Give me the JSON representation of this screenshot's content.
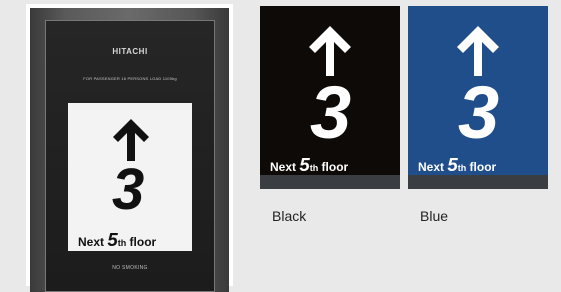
{
  "photo": {
    "brand": "HITACHI",
    "capacity_text": "FOR PASSENGER   16 PERSONS   LOAD   1100kg",
    "floor_number": "3",
    "next_word": "Next",
    "next_floor_number": "5",
    "next_floor_suffix": "th",
    "floor_word": "floor",
    "notice": "NO SMOKING"
  },
  "variants": [
    {
      "label": "Black",
      "background": "#0d0a08",
      "floor_number": "3",
      "next_word": "Next",
      "next_floor_number": "5",
      "next_floor_suffix": "th",
      "floor_word": "floor"
    },
    {
      "label": "Blue",
      "background": "#1f4e8b",
      "floor_number": "3",
      "next_word": "Next",
      "next_floor_number": "5",
      "next_floor_suffix": "th",
      "floor_word": "floor"
    }
  ],
  "colors": {
    "page_background": "#e9e9e9",
    "display_text_on_dark": "#ffffff",
    "display_text_on_light": "#111111",
    "footer_bar": "#3a3d42"
  },
  "icons": [
    "up-arrow-icon"
  ]
}
